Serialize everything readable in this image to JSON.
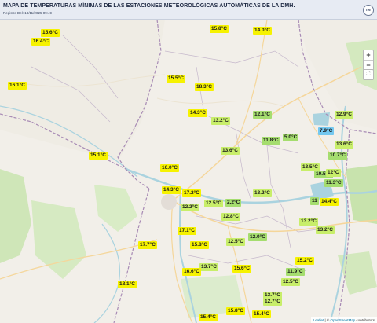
{
  "header": {
    "title": "MAPA DE TEMPERATURAS MÍNIMAS DE LAS ESTACIONES METEOROLÓGICAS AUTOMÁTICAS DE LA DMH.",
    "subtitle": "Registro Del: 18/11/2025 09:49",
    "logo_text": "ne"
  },
  "controls": {
    "zoom_in": "+",
    "zoom_out": "−",
    "fullscreen": "⛶"
  },
  "attribution": {
    "leaflet": "Leaflet",
    "separator": " | © ",
    "osm": "OpenStreetMap",
    "suffix": " contributors"
  },
  "stations": [
    {
      "value": "15.6°C",
      "color": "yellow"
    },
    {
      "value": "16.4°C",
      "color": "yellow"
    },
    {
      "value": "15.8°C",
      "color": "yellow"
    },
    {
      "value": "14.0°C",
      "color": "yellow"
    },
    {
      "value": "16.1°C",
      "color": "yellow"
    },
    {
      "value": "15.5°C",
      "color": "yellow"
    },
    {
      "value": "18.3°C",
      "color": "yellow"
    },
    {
      "value": "14.3°C",
      "color": "yellow"
    },
    {
      "value": "13.2°C",
      "color": "lime"
    },
    {
      "value": "12.1°C",
      "color": "green"
    },
    {
      "value": "12.9°C",
      "color": "lime"
    },
    {
      "value": "7.9°C",
      "color": "blue"
    },
    {
      "value": "11.8°C",
      "color": "green"
    },
    {
      "value": "5.0°C",
      "color": "green"
    },
    {
      "value": "13.6°C",
      "color": "lime"
    },
    {
      "value": "13.6°C",
      "color": "lime"
    },
    {
      "value": "15.1°C",
      "color": "yellow"
    },
    {
      "value": "16.0°C",
      "color": "yellow"
    },
    {
      "value": "13.5°C",
      "color": "lime"
    },
    {
      "value": "10.7°C",
      "color": "green"
    },
    {
      "value": "10.5°C",
      "color": "green"
    },
    {
      "value": "12°C",
      "color": "lime"
    },
    {
      "value": "11.3°C",
      "color": "green"
    },
    {
      "value": "14.3°C",
      "color": "yellow"
    },
    {
      "value": "17.2°C",
      "color": "yellow"
    },
    {
      "value": "13.2°C",
      "color": "lime"
    },
    {
      "value": "12.5°C",
      "color": "lime"
    },
    {
      "value": "2.2°C",
      "color": "green"
    },
    {
      "value": "12.2°C",
      "color": "lime"
    },
    {
      "value": "12.8°C",
      "color": "lime"
    },
    {
      "value": "11",
      "color": "green"
    },
    {
      "value": "14.4°C",
      "color": "yellow"
    },
    {
      "value": "13.2°C",
      "color": "lime"
    },
    {
      "value": "13.2°C",
      "color": "lime"
    },
    {
      "value": "17.1°C",
      "color": "yellow"
    },
    {
      "value": "12.0°C",
      "color": "green"
    },
    {
      "value": "17.7°C",
      "color": "yellow"
    },
    {
      "value": "15.8°C",
      "color": "yellow"
    },
    {
      "value": "12.5°C",
      "color": "lime"
    },
    {
      "value": "15.2°C",
      "color": "yellow"
    },
    {
      "value": "13.7°C",
      "color": "lime"
    },
    {
      "value": "15.6°C",
      "color": "yellow"
    },
    {
      "value": "16.6°C",
      "color": "yellow"
    },
    {
      "value": "11.9°C",
      "color": "green"
    },
    {
      "value": "18.1°C",
      "color": "yellow"
    },
    {
      "value": "12.5°C",
      "color": "lime"
    },
    {
      "value": "13.7°C",
      "color": "lime"
    },
    {
      "value": "12.7°C",
      "color": "lime"
    },
    {
      "value": "15.8°C",
      "color": "yellow"
    },
    {
      "value": "15.4°C",
      "color": "yellow"
    },
    {
      "value": "15.4°C",
      "color": "yellow"
    }
  ],
  "colors": {
    "yellow": "#f6f200",
    "lime": "#c8ee6a",
    "green": "#a5dd6f",
    "blue": "#74c8f0"
  }
}
